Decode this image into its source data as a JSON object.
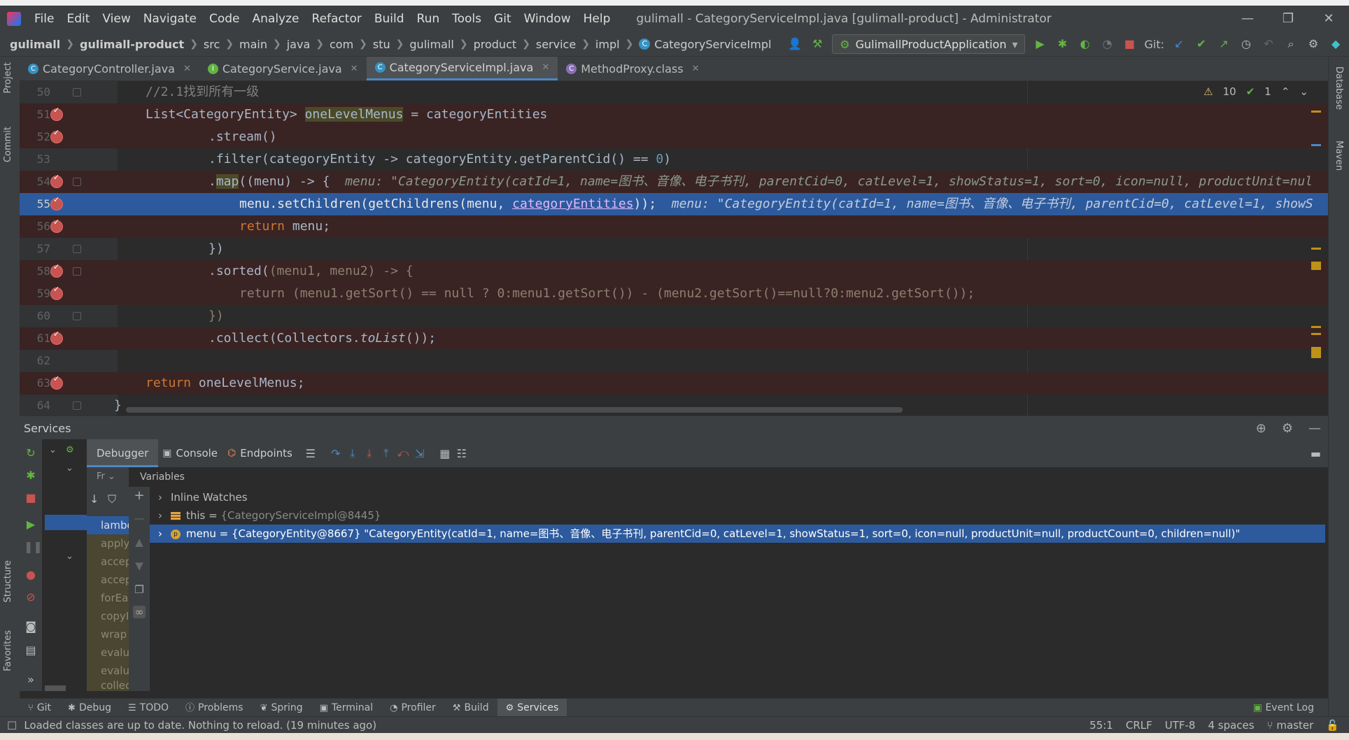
{
  "menubar": {
    "items": [
      "File",
      "Edit",
      "View",
      "Navigate",
      "Code",
      "Analyze",
      "Refactor",
      "Build",
      "Run",
      "Tools",
      "Git",
      "Window",
      "Help"
    ],
    "window_title": "gulimall - CategoryServiceImpl.java [gulimall-product] - Administrator",
    "controls": [
      "—",
      "❐",
      "✕"
    ]
  },
  "navbar": {
    "breadcrumbs": [
      "gulimall",
      "gulimall-product",
      "src",
      "main",
      "java",
      "com",
      "stu",
      "gulimall",
      "product",
      "service",
      "impl",
      "CategoryServiceImpl"
    ],
    "run_config": "GulimallProductApplication",
    "git_label": "Git:"
  },
  "tabs": [
    {
      "label": "CategoryController.java",
      "icon": "class-icon"
    },
    {
      "label": "CategoryService.java",
      "icon": "interface-icon"
    },
    {
      "label": "CategoryServiceImpl.java",
      "icon": "class-icon",
      "active": true
    },
    {
      "label": "MethodProxy.class",
      "icon": "class-icon"
    }
  ],
  "left_strip": [
    "Project",
    "Commit",
    "Structure",
    "Favorites"
  ],
  "right_strip": [
    "Database",
    "Maven"
  ],
  "editor": {
    "inspections": {
      "warnings": "10",
      "ok": "1"
    },
    "lines": [
      {
        "num": "50",
        "bp": false,
        "html_key": "l50"
      },
      {
        "num": "51",
        "bp": true
      },
      {
        "num": "52",
        "bp": true
      },
      {
        "num": "53",
        "bp": false
      },
      {
        "num": "54",
        "bp": true
      },
      {
        "num": "55",
        "bp": true,
        "current": true
      },
      {
        "num": "56",
        "bp": true
      },
      {
        "num": "57",
        "bp": false
      },
      {
        "num": "58",
        "bp": true
      },
      {
        "num": "59",
        "bp": true
      },
      {
        "num": "60",
        "bp": false
      },
      {
        "num": "61",
        "bp": true
      },
      {
        "num": "62",
        "bp": false
      },
      {
        "num": "63",
        "bp": true
      },
      {
        "num": "64",
        "bp": false
      }
    ],
    "code": {
      "l50": "//2.1找到所有一级",
      "l51_a": "List<CategoryEntity> ",
      "l51_b": "oneLevelMenus",
      "l51_c": " = categoryEntities",
      "l52": ".stream()",
      "l53_a": ".filter(categoryEntity -> categoryEntity.getParentCid() == ",
      "l53_b": "0",
      "l53_c": ")",
      "l54_a": ".",
      "l54_b": "map",
      "l54_c": "((menu) -> {",
      "l54_hint": "menu: \"CategoryEntity(catId=1, name=图书、音像、电子书刊, parentCid=0, catLevel=1, showStatus=1, sort=0, icon=null, productUnit=nul",
      "l55_a": "menu.setChildren(getChildrens(menu, ",
      "l55_b": "categoryEntities",
      "l55_c": "));",
      "l55_hint": "menu: \"CategoryEntity(catId=1, name=图书、音像、电子书刊, parentCid=0, catLevel=1, showS",
      "l56_a": "return",
      "l56_b": " menu;",
      "l57": "})",
      "l58_a": ".sorted(",
      "l58_b": "(menu1, menu2) -> {",
      "l59": "return (menu1.getSort() == null ? 0:menu1.getSort()) - (menu2.getSort()==null?0:menu2.getSort());",
      "l60": "})",
      "l61_a": ".collect(Collectors.",
      "l61_b": "toList",
      "l61_c": "());",
      "l62": "",
      "l63_a": "return",
      "l63_b": " oneLevelMenus;",
      "l64": "}"
    }
  },
  "services": {
    "title": "Services",
    "debug_tabs": [
      "Debugger",
      "Console",
      "Endpoints"
    ],
    "frames_header": "Fr",
    "frames": [
      "lambda",
      "apply",
      "accept",
      "accept",
      "forEach",
      "copyI",
      "wrap",
      "evalu",
      "evalu",
      "collec"
    ],
    "variables_header": "Variables",
    "variables": [
      {
        "name": "Inline Watches",
        "value": ""
      },
      {
        "name": "this",
        "value": "{CategoryServiceImpl@8445}"
      },
      {
        "name": "menu",
        "value": "{CategoryEntity@8667} \"CategoryEntity(catId=1, name=图书、音像、电子书刊, parentCid=0, catLevel=1, showStatus=1, sort=0, icon=null, productUnit=null, productCount=0, children=null)\""
      }
    ]
  },
  "bottom_tabs": [
    "Git",
    "Debug",
    "TODO",
    "Problems",
    "Spring",
    "Terminal",
    "Profiler",
    "Build",
    "Services"
  ],
  "event_log": "Event Log",
  "status": {
    "message": "Loaded classes are up to date. Nothing to reload. (19 minutes ago)",
    "position": "55:1",
    "line_sep": "CRLF",
    "encoding": "UTF-8",
    "indent": "4 spaces",
    "branch": "master"
  },
  "colors": {
    "accent": "#4a88c7",
    "breakpoint": "#c75450",
    "selection": "#2d5a9c"
  }
}
